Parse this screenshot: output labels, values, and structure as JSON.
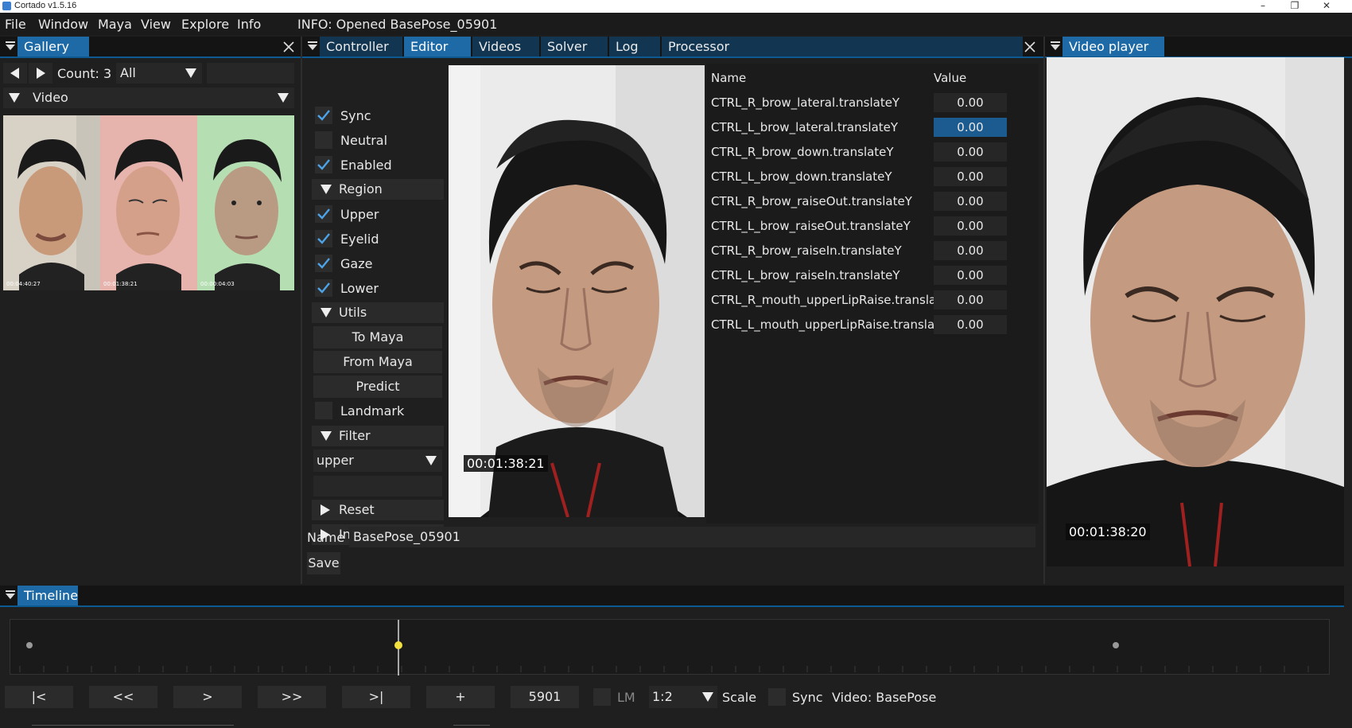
{
  "app": {
    "title": "Cortado v1.5.16"
  },
  "menu": {
    "items": [
      "File",
      "Window",
      "Maya",
      "View",
      "Explore",
      "Info"
    ],
    "info": "INFO: Opened BasePose_05901"
  },
  "gallery": {
    "title": "Gallery",
    "count_label": "Count:",
    "count_value": "3",
    "filter_value": "All",
    "video_label": "Video",
    "thumbs": [
      {
        "time": "00:04:40:27",
        "bg": "#d9d2c4"
      },
      {
        "time": "00:01:38:21",
        "bg": "#e9b4b1"
      },
      {
        "time": "00:00:04:03",
        "bg": "#b7e0b4"
      }
    ]
  },
  "center_tabs": [
    "Controller",
    "Editor",
    "Videos",
    "Solver",
    "Log",
    "Processor"
  ],
  "controller": {
    "checks": [
      {
        "label": "Sync",
        "checked": true
      },
      {
        "label": "Neutral",
        "checked": false
      },
      {
        "label": "Enabled",
        "checked": true
      }
    ],
    "region_label": "Region",
    "region_checks": [
      {
        "label": "Upper",
        "checked": true
      },
      {
        "label": "Eyelid",
        "checked": true
      },
      {
        "label": "Gaze",
        "checked": true
      },
      {
        "label": "Lower",
        "checked": true
      }
    ],
    "utils_label": "Utils",
    "utils_buttons": [
      "To Maya",
      "From Maya",
      "Predict"
    ],
    "landmark_label": "Landmark",
    "filter_label": "Filter",
    "filter_value": "upper",
    "reset_label": "Reset",
    "info_label": "Info"
  },
  "preview": {
    "timestamp": "00:01:38:21"
  },
  "table": {
    "header_name": "Name",
    "header_value": "Value",
    "rows": [
      {
        "name": "CTRL_R_brow_lateral.translateY",
        "value": "0.00"
      },
      {
        "name": "CTRL_L_brow_lateral.translateY",
        "value": "0.00"
      },
      {
        "name": "CTRL_R_brow_down.translateY",
        "value": "0.00"
      },
      {
        "name": "CTRL_L_brow_down.translateY",
        "value": "0.00"
      },
      {
        "name": "CTRL_R_brow_raiseOut.translateY",
        "value": "0.00"
      },
      {
        "name": "CTRL_L_brow_raiseOut.translateY",
        "value": "0.00"
      },
      {
        "name": "CTRL_R_brow_raiseIn.translateY",
        "value": "0.00"
      },
      {
        "name": "CTRL_L_brow_raiseIn.translateY",
        "value": "0.00"
      },
      {
        "name": "CTRL_R_mouth_upperLipRaise.translateY",
        "value": "0.00"
      },
      {
        "name": "CTRL_L_mouth_upperLipRaise.translateY",
        "value": "0.00"
      }
    ],
    "selected_row": 1
  },
  "pose": {
    "name_label": "Name",
    "name_value": "BasePose_05901",
    "save_label": "Save"
  },
  "video_player": {
    "title": "Video player",
    "timestamp": "00:01:38:20"
  },
  "timeline": {
    "title": "Timeline",
    "buttons": [
      "|<",
      "<<",
      ">",
      ">>",
      ">|",
      "+"
    ],
    "frame": "5901",
    "lm_label": "LM",
    "ratio": "1:2",
    "scale_label": "Scale",
    "sync_label": "Sync",
    "video_label": "Video: BasePose"
  },
  "colors": {
    "accent": "#1e6aa6",
    "tab_inactive": "#123652",
    "selected_value": "#1c5b8f",
    "playhead": "#f0e040"
  }
}
